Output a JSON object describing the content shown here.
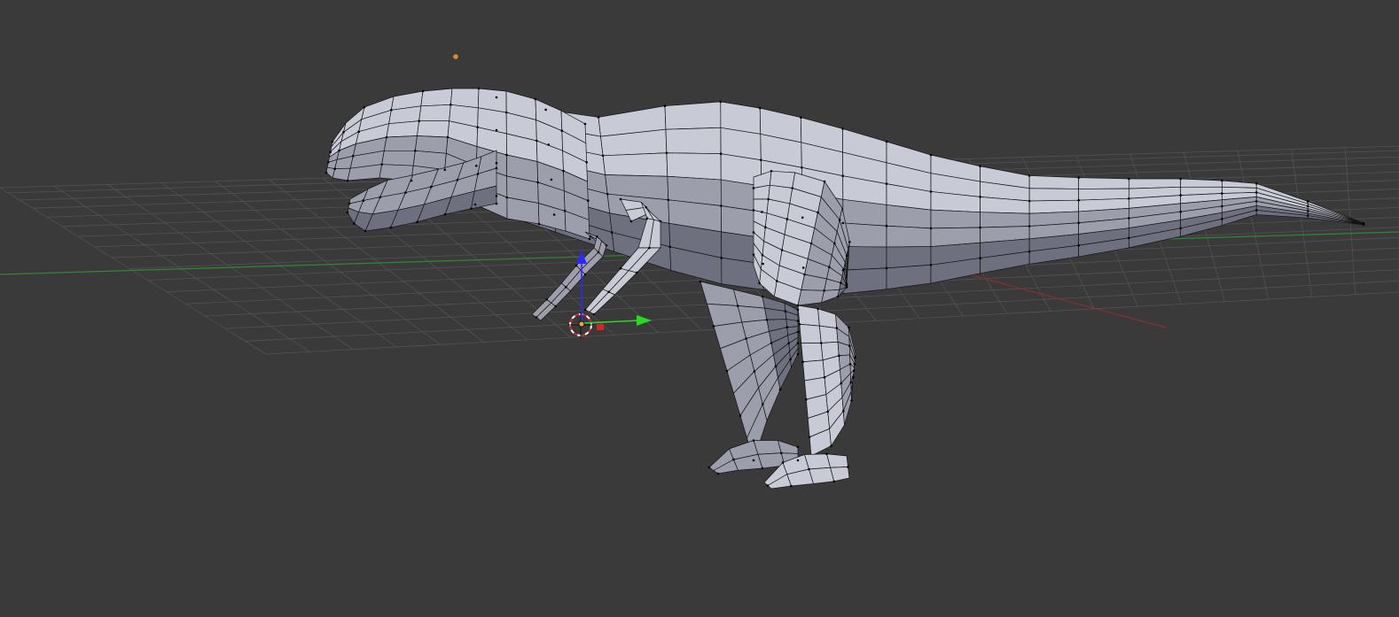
{
  "viewport": {
    "mode": "edit-mode",
    "object": "low-poly-dinosaur-mesh",
    "colors": {
      "background": "#3a3a3a",
      "grid": "#525252",
      "x_axis": "#8a2f2f",
      "y_axis": "#2e8a2e",
      "mesh_light": "#c8cad6",
      "mesh_mid": "#9c9eac",
      "mesh_dark": "#6e7080",
      "wire": "#141414",
      "vertex": "#000000",
      "lamp": "#e08a2c",
      "gizmo_z": "#2a2aff",
      "gizmo_y": "#22dd22",
      "gizmo_x": "#dd2222"
    },
    "icons": {
      "lamp": "lamp-icon",
      "origin": "object-origin-icon",
      "gizmo": "transform-gizmo-icon",
      "cursor": "3d-cursor-icon"
    }
  }
}
